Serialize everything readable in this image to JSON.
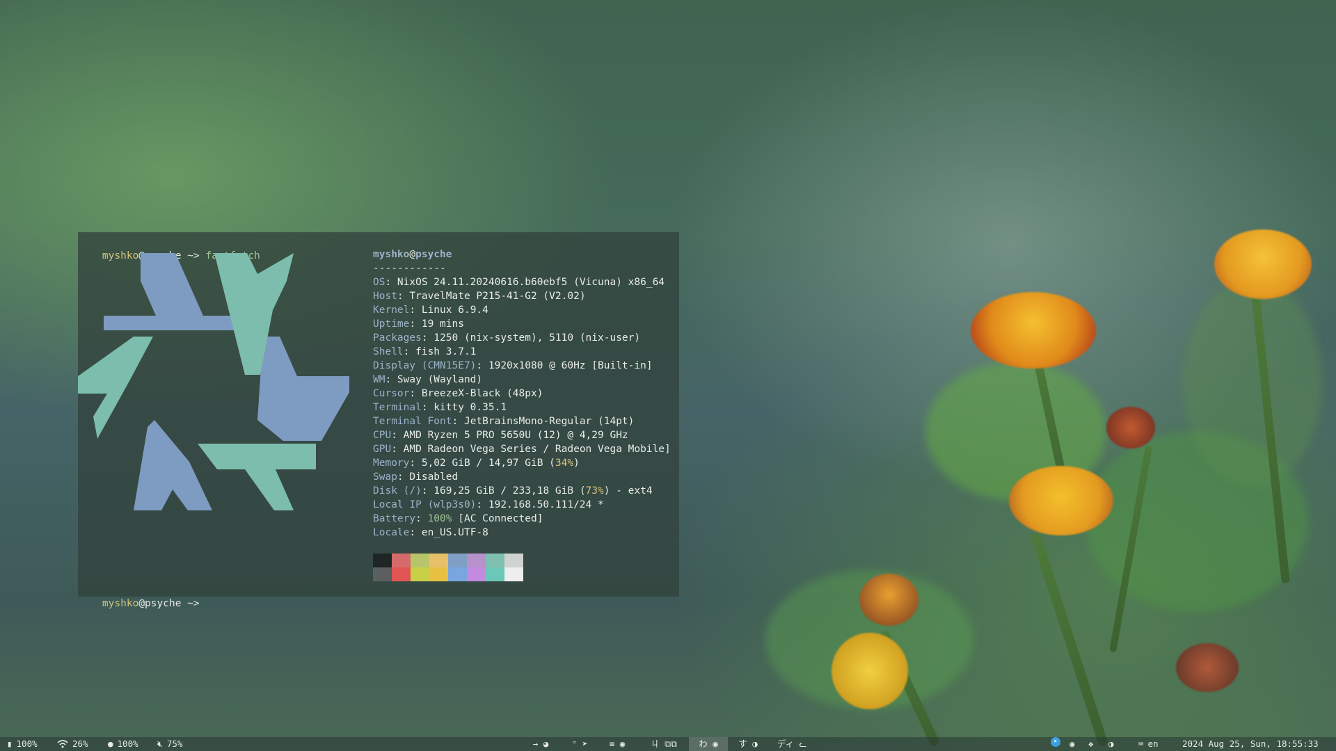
{
  "terminal": {
    "prompt1": {
      "user": "myshko",
      "host": "@psyche",
      "arrow": " ~> ",
      "command": "fastfetch"
    },
    "prompt2": {
      "user": "myshko",
      "host": "@psyche",
      "arrow": " ~> "
    },
    "info_title": {
      "user": "myshko",
      "at": "@",
      "host": "psyche"
    },
    "separator": "------------",
    "info": [
      {
        "key": "OS",
        "value": ": NixOS 24.11.20240616.b60ebf5 (Vicuna) x86_64"
      },
      {
        "key": "Host",
        "value": ": TravelMate P215-41-G2 (V2.02)"
      },
      {
        "key": "Kernel",
        "value": ": Linux 6.9.4"
      },
      {
        "key": "Uptime",
        "value": ": 19 mins"
      },
      {
        "key": "Packages",
        "value": ": 1250 (nix-system), 5110 (nix-user)"
      },
      {
        "key": "Shell",
        "value": ": fish 3.7.1"
      },
      {
        "key": "Display (CMN15E7)",
        "value": ": 1920x1080 @ 60Hz [Built-in]"
      },
      {
        "key": "WM",
        "value": ": Sway (Wayland)"
      },
      {
        "key": "Cursor",
        "value": ": BreezeX-Black (48px)"
      },
      {
        "key": "Terminal",
        "value": ": kitty 0.35.1"
      },
      {
        "key": "Terminal Font",
        "value": ": JetBrainsMono-Regular (14pt)"
      },
      {
        "key": "CPU",
        "value": ": AMD Ryzen 5 PRO 5650U (12) @ 4,29 GHz"
      },
      {
        "key": "GPU",
        "value": ": AMD Radeon Vega Series / Radeon Vega Mobile]"
      }
    ],
    "memory": {
      "key": "Memory",
      "value": ": 5,02 GiB / 14,97 GiB (",
      "pct": "34%",
      "tail": ")"
    },
    "swap": {
      "key": "Swap",
      "value": ": Disabled"
    },
    "disk": {
      "key": "Disk (/)",
      "value": ": 169,25 GiB / 233,18 GiB (",
      "pct": "73%",
      "tail": ") - ext4"
    },
    "localip": {
      "key": "Local IP (wlp3s0)",
      "value": ": 192.168.50.111/24 *"
    },
    "battery": {
      "key": "Battery",
      "sep": ": ",
      "pct": "100%",
      "tail": " [AC Connected]"
    },
    "locale": {
      "key": "Locale",
      "value": ": en_US.UTF-8"
    },
    "palette_top": [
      "#1f2424",
      "#d46a6a",
      "#b8c46a",
      "#e8c06a",
      "#7f9fc4",
      "#b592c9",
      "#7fbfb2",
      "#cfd3cf"
    ],
    "palette_bottom": [
      "#5a5f5f",
      "#e05454",
      "#c8d048",
      "#e8c040",
      "#7aa6e0",
      "#c48ae0",
      "#6ac8b8",
      "#eeeeee"
    ],
    "logo_colors": {
      "blue": "#7e9cc2",
      "teal": "#7dbdad"
    }
  },
  "statusbar": {
    "battery": {
      "icon": "battery-icon",
      "value": "100%"
    },
    "wifi": {
      "icon": "wifi-icon",
      "value": "26%"
    },
    "brightness": {
      "icon": "brightness-icon",
      "value": "100%"
    },
    "volume": {
      "icon": "volume-muted-icon",
      "value": "75%"
    },
    "workspaces": [
      {
        "label": "→",
        "icon": "pie-icon"
      },
      {
        "label": "⁼",
        "icon": "telegram-icon"
      },
      {
        "label": "≡",
        "icon": "discord-icon"
      },
      {
        "label": "ㄐ",
        "icon": "windows-icon"
      },
      {
        "label": "わ",
        "icon": "discord-icon"
      },
      {
        "label": "す",
        "icon": "steam-icon"
      },
      {
        "label": "ディ",
        "icon": "cat-icon"
      }
    ],
    "tray": [
      "telegram-icon",
      "discord-icon",
      "dropbox-icon",
      "steam-icon"
    ],
    "keyboard_layout": "en",
    "datetime": "2024 Aug 25, Sun, 18:55:33"
  }
}
